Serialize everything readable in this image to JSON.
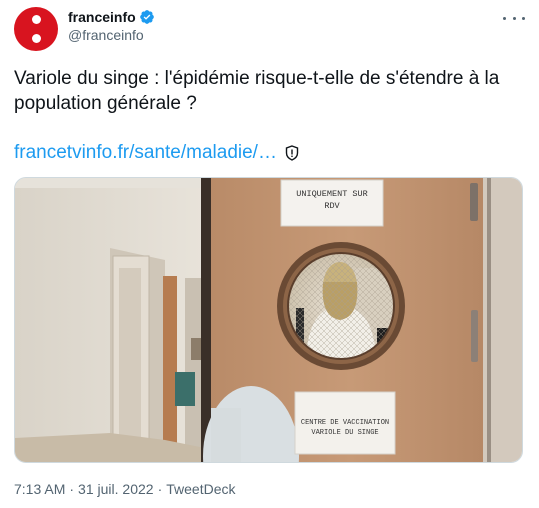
{
  "author": {
    "display_name": "franceinfo",
    "handle": "@franceinfo",
    "verified": true
  },
  "tweet": {
    "text": "Variole du singe : l'épidémie risque-t-elle de s'étendre à la population générale ?",
    "link_text": "francetvinfo.fr/sante/maladie/…"
  },
  "image": {
    "sign_top": "UNIQUEMENT SUR\nRDV",
    "sign_bottom": "CENTRE DE VACCINATION\nVARIOLE DU SINGE"
  },
  "footer": {
    "time": "7:13 AM",
    "separator_1": "·",
    "date": "31 juil. 2022",
    "separator_2": "·",
    "source": "TweetDeck"
  },
  "colors": {
    "brand_red": "#d8141f",
    "link_blue": "#1d9bf0",
    "verified_blue": "#1d9bf0",
    "muted": "#536471"
  },
  "icons": {
    "more": "more-dots-icon",
    "verified": "verified-badge-icon",
    "warning": "shield-icon"
  }
}
